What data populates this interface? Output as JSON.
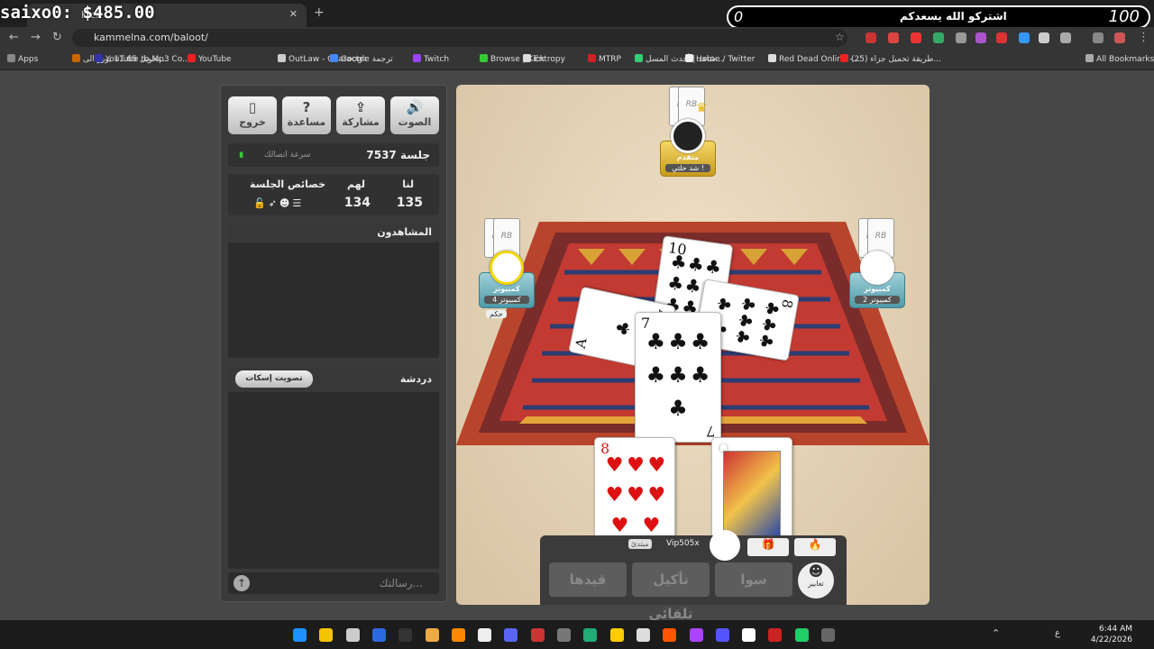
{
  "overlay": {
    "left": "saixo0: $485.00",
    "zero": "0",
    "message": "اشتركو الله يسعدكم",
    "num": "100"
  },
  "browser": {
    "tab_title": "Kick",
    "url": "kammelna.com/baloot/",
    "bookmarks": [
      "Apps",
      "تحويل 11.65 يورو الى...",
      "YouTube to Mp3 Co...",
      "YouTube",
      "OutLaw - Character",
      "Google ترجمة",
      "Twitch",
      "Browse | Kick",
      "Entropy",
      "MTRP",
      "شاهد | أحدث المسل...",
      "Home / Twitter",
      "Red Dead Online -...",
      "(25) طريقة تحميل جزاء...",
      "All Bookmarks"
    ],
    "bookmark_colors": [
      "#888",
      "#c60",
      "#33a",
      "#e22",
      "#ccc",
      "#48f",
      "#94f",
      "#3c3",
      "#ddd",
      "#c22",
      "#3c7",
      "#eee",
      "#ddd",
      "#e22",
      "#aaa"
    ]
  },
  "sidebar": {
    "buttons": [
      {
        "label": "خروج",
        "icon": "exit-icon",
        "glyph": "▯"
      },
      {
        "label": "مساعدة",
        "icon": "help-icon",
        "glyph": "?"
      },
      {
        "label": "مشاركة",
        "icon": "share-icon",
        "glyph": "⇪"
      },
      {
        "label": "الصوت",
        "icon": "sound-icon",
        "glyph": "🔊"
      }
    ],
    "session": "جلسة 7537",
    "speed": "سرعة اتصالك",
    "signal": "IIIII",
    "scores": {
      "ours_label": "لنا",
      "theirs_label": "لهم",
      "props_label": "خصائص الجلسة",
      "ours": "135",
      "theirs": "134",
      "prop_icons": "🔓➶☻☰"
    },
    "viewers_label": "المشاهدون",
    "chat_label": "دردشة",
    "mute_label": "تصويت إسكات",
    "message_placeholder": "رسالتك..."
  },
  "game": {
    "top_player": {
      "name": "متقدم",
      "sub": "شد حلتي !"
    },
    "left_player": {
      "name": "كمبيوتر",
      "sub": "كمبيوتر 4",
      "tag": "حكم"
    },
    "right_player": {
      "name": "كمبيوتر",
      "sub": "كمبيوتر 2"
    },
    "hand_back": "RB",
    "table_cards": [
      {
        "rank": "10",
        "suit": "♣",
        "color": "#111",
        "pips": 10
      },
      {
        "rank": "A",
        "suit": "♣",
        "color": "#111",
        "pips": 1
      },
      {
        "rank": "8",
        "suit": "♣",
        "color": "#111",
        "pips": 8
      },
      {
        "rank": "7",
        "suit": "♣",
        "color": "#111",
        "pips": 7
      }
    ],
    "hand_cards": [
      {
        "rank": "8",
        "suit": "♥",
        "color": "#d11",
        "pips": 8
      },
      {
        "rank": "Q",
        "suit": "♦",
        "color": "#d11",
        "pips": 1
      }
    ],
    "user": {
      "name": "Vip505x",
      "badge": "مبتدئ"
    },
    "actions": [
      "قيدها",
      "تأكيل تلقائي",
      "سوا",
      "تعابير"
    ]
  },
  "taskbar": {
    "time": "6:44 AM",
    "date": "4/22/2026",
    "lang": "ع",
    "icons": [
      "#1e90ff",
      "#f5c400",
      "#ccc",
      "#2b6ae0",
      "#333",
      "#ea4",
      "#f80",
      "#eee",
      "#5865f2",
      "#c33",
      "#777",
      "#2a7",
      "#fc0",
      "#ddd",
      "#f50",
      "#a4f",
      "#55f",
      "#fff",
      "#c22",
      "#2c6",
      "#666"
    ]
  }
}
